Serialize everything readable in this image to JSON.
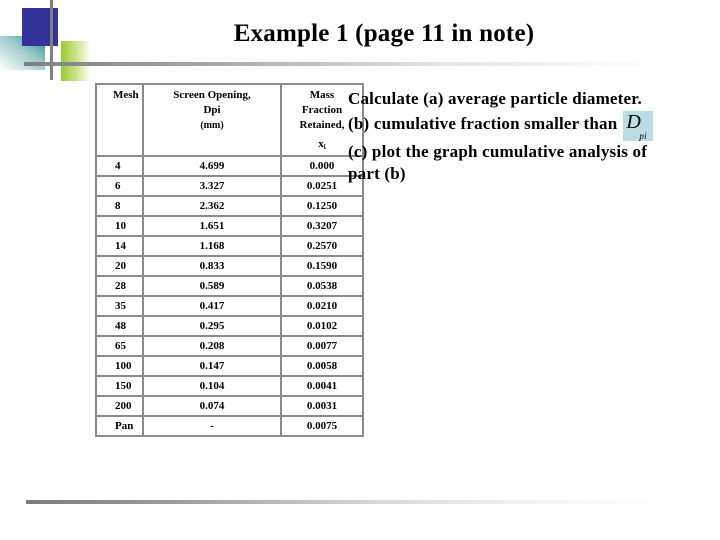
{
  "slide": {
    "title": "Example 1 (page 11 in note)"
  },
  "table": {
    "headers": {
      "mesh": "Mesh",
      "opening_line1": "Screen Opening,",
      "opening_line2": "Dpi",
      "opening_line3": "(mm)",
      "fraction_line1": "Mass",
      "fraction_line2": "Fraction",
      "fraction_line3": "Retained,",
      "fraction_symbol": "x",
      "fraction_subscript": "i"
    },
    "rows": [
      {
        "mesh": "4",
        "opening": "4.699",
        "fraction": "0.000"
      },
      {
        "mesh": "6",
        "opening": "3.327",
        "fraction": "0.0251"
      },
      {
        "mesh": "8",
        "opening": "2.362",
        "fraction": "0.1250"
      },
      {
        "mesh": "10",
        "opening": "1.651",
        "fraction": "0.3207"
      },
      {
        "mesh": "14",
        "opening": "1.168",
        "fraction": "0.2570"
      },
      {
        "mesh": "20",
        "opening": "0.833",
        "fraction": "0.1590"
      },
      {
        "mesh": "28",
        "opening": "0.589",
        "fraction": "0.0538"
      },
      {
        "mesh": "35",
        "opening": "0.417",
        "fraction": "0.0210"
      },
      {
        "mesh": "48",
        "opening": "0.295",
        "fraction": "0.0102"
      },
      {
        "mesh": "65",
        "opening": "0.208",
        "fraction": "0.0077"
      },
      {
        "mesh": "100",
        "opening": "0.147",
        "fraction": "0.0058"
      },
      {
        "mesh": "150",
        "opening": "0.104",
        "fraction": "0.0041"
      },
      {
        "mesh": "200",
        "opening": "0.074",
        "fraction": "0.0031"
      },
      {
        "mesh": "Pan",
        "opening": "-",
        "fraction": "0.0075"
      }
    ]
  },
  "question": {
    "line_a": "Calculate (a) average particle diameter.",
    "line_b": "(b) cumulative fraction smaller than",
    "formula_main": "D",
    "formula_sub": "pi",
    "line_c": "(c) plot the graph cumulative analysis of",
    "line_d": "part (b)"
  },
  "colors": {
    "accent_blue": "#333399",
    "accent_teal": "#2a9090",
    "accent_green": "#99cc33",
    "rule_gray": "#808080",
    "formula_bg": "#b9dde3"
  }
}
